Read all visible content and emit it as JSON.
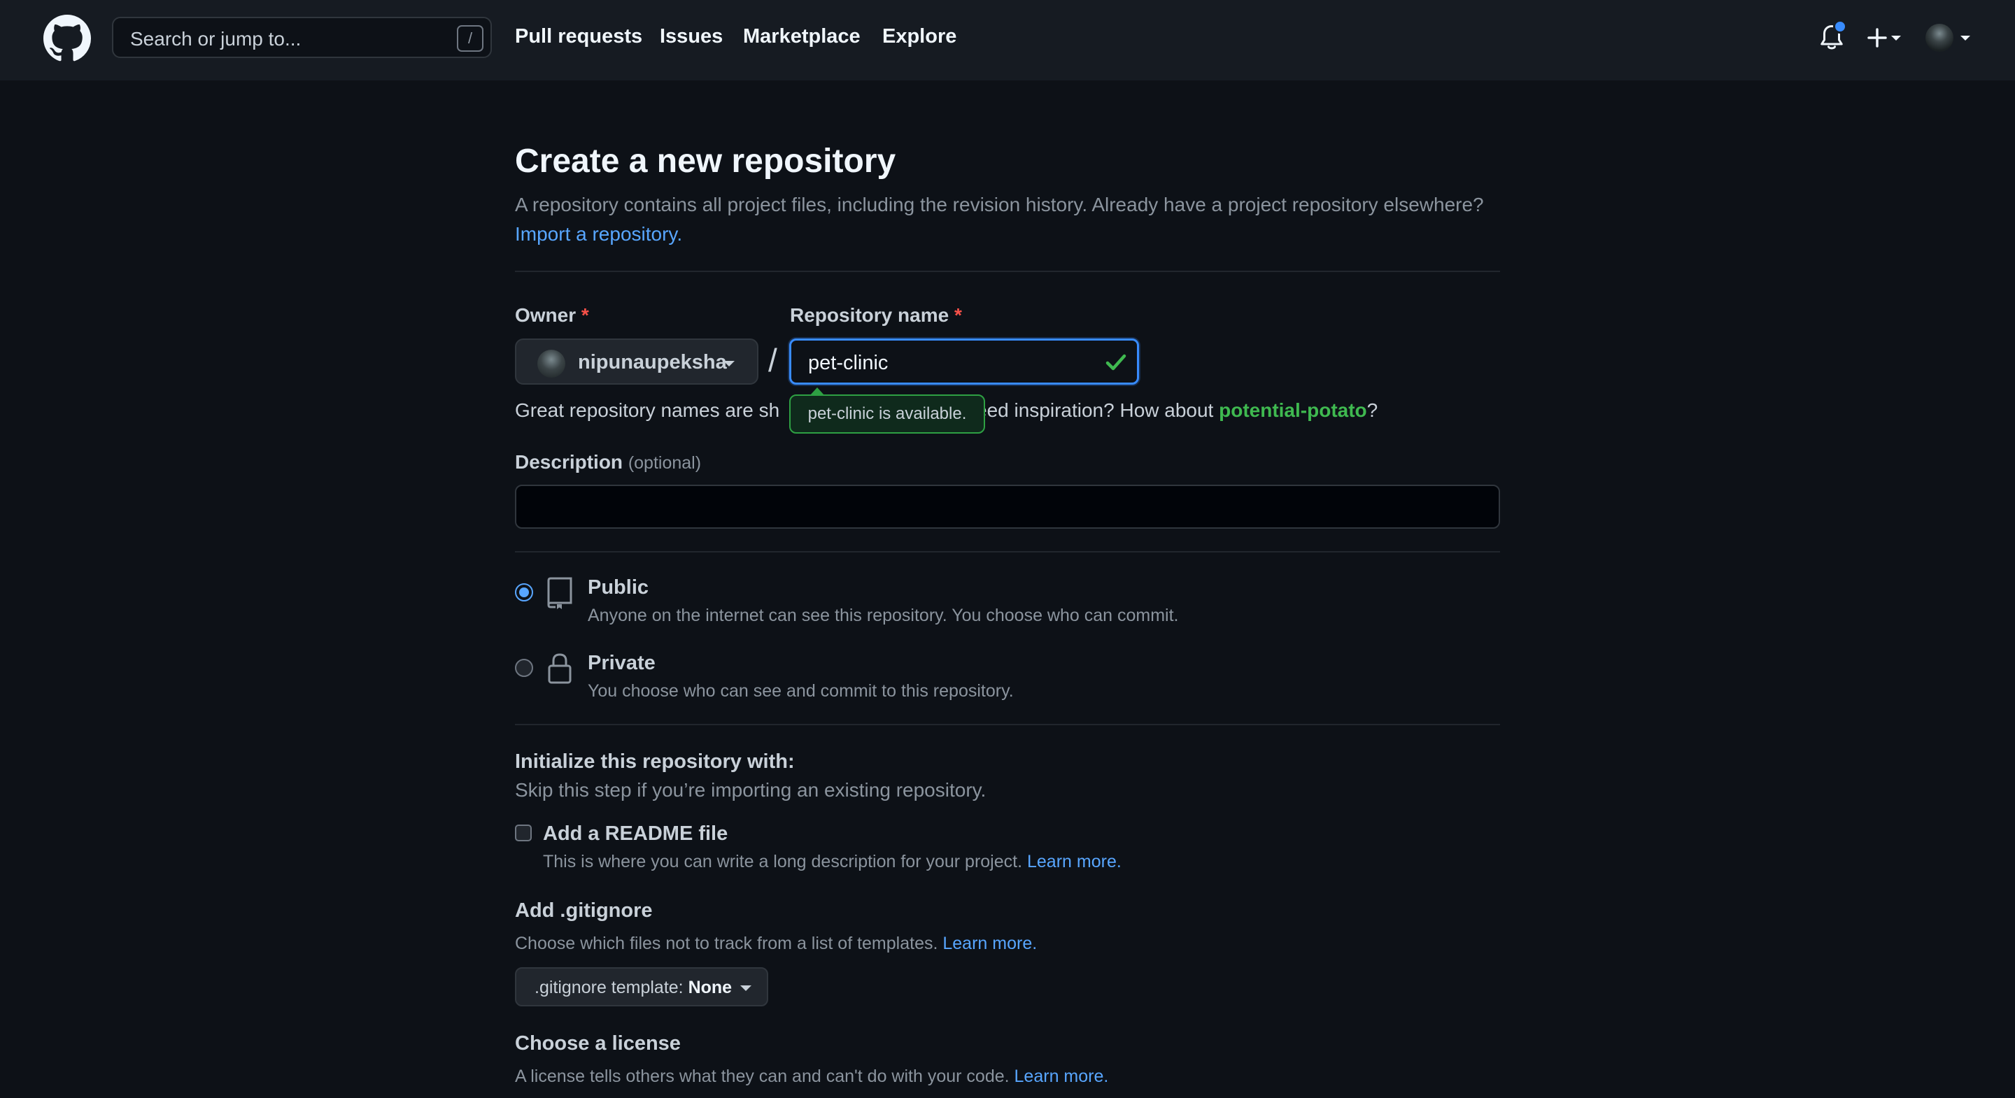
{
  "header": {
    "search_placeholder": "Search or jump to...",
    "search_shortcut": "/",
    "nav": [
      "Pull requests",
      "Issues",
      "Marketplace",
      "Explore"
    ]
  },
  "page": {
    "title": "Create a new repository",
    "description": "A repository contains all project files, including the revision history. Already have a project repository elsewhere?",
    "import_link": "Import a repository."
  },
  "owner": {
    "label": "Owner",
    "required_mark": "*",
    "value": "nipunaupeksha"
  },
  "separator": "/",
  "repo_name": {
    "label": "Repository name",
    "required_mark": "*",
    "value": "pet-clinic",
    "tooltip": "pet-clinic is available."
  },
  "hint": {
    "prefix": "Great repository names are sh",
    "middle": "eed inspiration? How about",
    "suggestion": "potential-potato",
    "suffix": "?"
  },
  "description_field": {
    "label": "Description",
    "optional": "(optional)",
    "value": ""
  },
  "visibility": [
    {
      "title": "Public",
      "desc": "Anyone on the internet can see this repository. You choose who can commit.",
      "checked": true
    },
    {
      "title": "Private",
      "desc": "You choose who can see and commit to this repository.",
      "checked": false
    }
  ],
  "initialize": {
    "title": "Initialize this repository with:",
    "subtitle": "Skip this step if you’re importing an existing repository.",
    "readme_label": "Add a README file",
    "readme_desc": "This is where you can write a long description for your project.",
    "readme_link": "Learn more."
  },
  "gitignore": {
    "title": "Add .gitignore",
    "desc": "Choose which files not to track from a list of templates.",
    "link": "Learn more.",
    "select_prefix": ".gitignore template:",
    "select_value": "None"
  },
  "license": {
    "title": "Choose a license",
    "desc": "A license tells others what they can and can't do with your code.",
    "link": "Learn more."
  },
  "colors": {
    "background": "#0d1117",
    "header": "#161b22",
    "accent": "#58a6ff",
    "success": "#3fb950",
    "required": "#f85149"
  }
}
